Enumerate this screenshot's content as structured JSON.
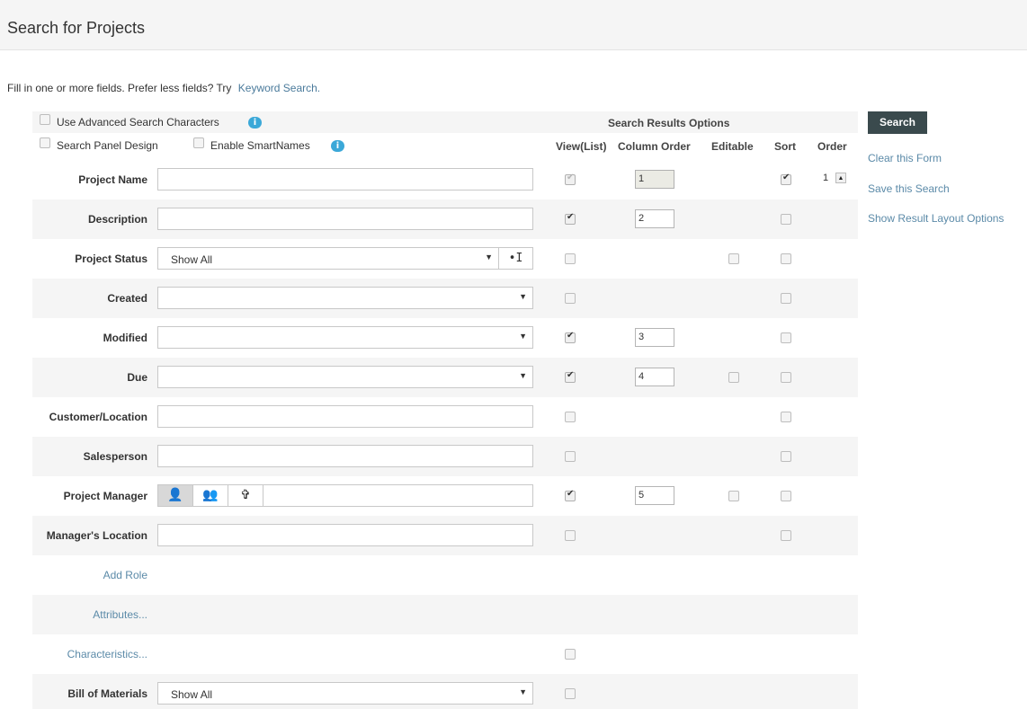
{
  "page": {
    "title": "Search for Projects"
  },
  "intro": {
    "text": "Fill in one or more fields. Prefer less fields? Try",
    "link": "Keyword Search."
  },
  "options": {
    "advanced_chars": "Use Advanced Search Characters",
    "panel_design": "Search Panel Design",
    "smartnames": "Enable SmartNames"
  },
  "results_header": {
    "title": "Search Results Options",
    "view": "View(List)",
    "column_order": "Column Order",
    "editable": "Editable",
    "sort": "Sort",
    "order": "Order"
  },
  "rows": {
    "project_name": {
      "label": "Project Name",
      "column_order": "1",
      "order": "1"
    },
    "description": {
      "label": "Description",
      "column_order": "2"
    },
    "project_status": {
      "label": "Project Status",
      "value": "Show All"
    },
    "created": {
      "label": "Created",
      "value": ""
    },
    "modified": {
      "label": "Modified",
      "value": "",
      "column_order": "3"
    },
    "due": {
      "label": "Due",
      "value": "",
      "column_order": "4"
    },
    "customer_location": {
      "label": "Customer/Location"
    },
    "salesperson": {
      "label": "Salesperson"
    },
    "project_manager": {
      "label": "Project Manager",
      "column_order": "5"
    },
    "managers_location": {
      "label": "Manager's Location"
    },
    "add_role": {
      "label": "Add Role"
    },
    "attributes": {
      "label": "Attributes..."
    },
    "characteristics": {
      "label": "Characteristics..."
    },
    "bill_of_materials": {
      "label": "Bill of Materials",
      "value": "Show All"
    }
  },
  "sidebar": {
    "search": "Search",
    "clear": "Clear this Form",
    "save": "Save this Search",
    "layout": "Show Result Layout Options"
  },
  "icons": {
    "info": "info-icon",
    "dropdown": "chevron-down-icon",
    "text_cursor": "text-cursor-icon",
    "user": "user-icon",
    "group": "group-icon",
    "role": "role-icon",
    "sort_asc": "sort-ascending-icon"
  }
}
